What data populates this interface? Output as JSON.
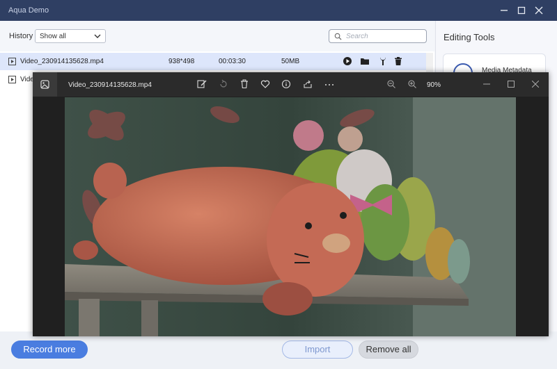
{
  "app": {
    "title": "Aqua Demo"
  },
  "toolbar": {
    "history_label": "History",
    "filter_value": "Show all",
    "search_placeholder": "Search"
  },
  "rows": [
    {
      "name": "Video_230914135628.mp4",
      "resolution": "938*498",
      "duration": "00:03:30",
      "size": "50MB",
      "selected": true
    },
    {
      "name": "Vide",
      "resolution": "",
      "duration": "",
      "size": "",
      "selected": false
    }
  ],
  "right_panel": {
    "heading": "Editing Tools",
    "tools": [
      {
        "label": "Media Metadata",
        "icon": "info-circle-icon"
      }
    ]
  },
  "bottom": {
    "record_label": "Record more",
    "import_label": "Import",
    "remove_label": "Remove all"
  },
  "viewer": {
    "filename": "Video_230914135628.mp4",
    "zoom": "90%"
  },
  "colors": {
    "titlebar": "#2f3f63",
    "accent": "#4a7de0",
    "selected_row": "#dde6fb",
    "viewer_bg": "#202020"
  }
}
